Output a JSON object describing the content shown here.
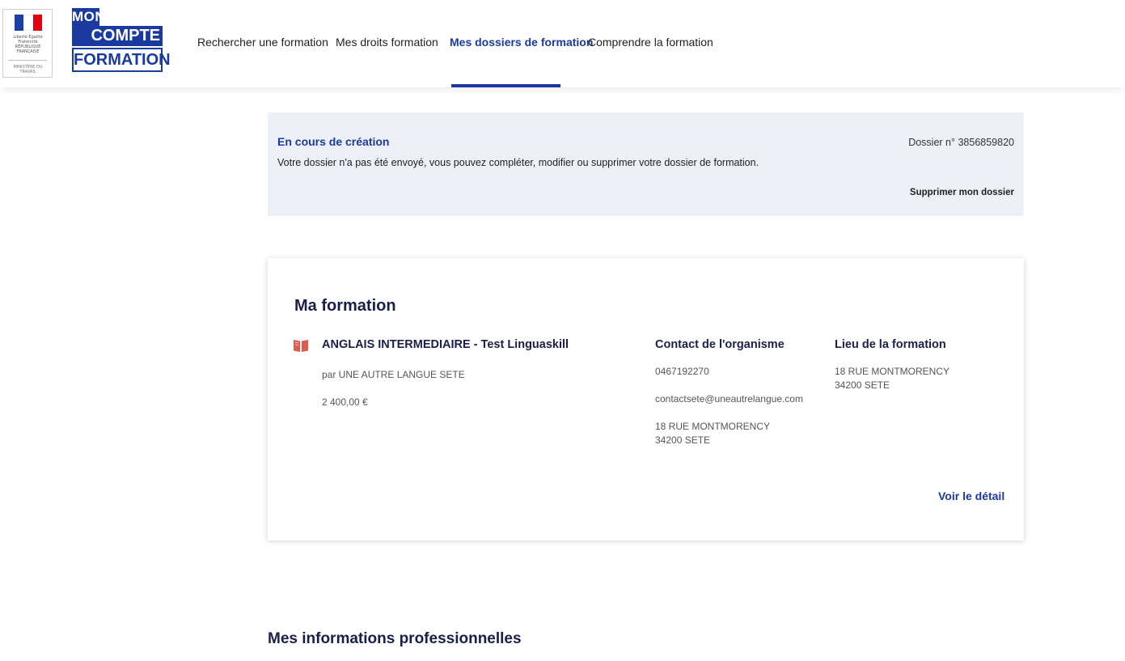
{
  "header": {
    "mcf_logo": {
      "line1": "MON",
      "line2": "COMPTE",
      "line3": "FORMATION"
    },
    "marianne": {
      "text": "Liberté Égalité Fraternité RÉPUBLIQUE FRANÇAISE",
      "sub": "MINISTÈRE DU TRAVAIL"
    },
    "nav": [
      {
        "label": "Rechercher une formation"
      },
      {
        "label": "Mes droits formation"
      },
      {
        "label": "Mes dossiers de formation",
        "active": true
      },
      {
        "label": "Comprendre la formation"
      }
    ]
  },
  "status": {
    "title": "En cours de création",
    "description": "Votre dossier n'a pas été envoyé, vous pouvez compléter, modifier ou supprimer votre dossier de formation.",
    "dossier_number": "Dossier n° 3856859820",
    "delete_label": "Supprimer mon dossier"
  },
  "formation": {
    "section_title": "Ma formation",
    "course_title": "ANGLAIS INTERMEDIAIRE - Test Linguaskill",
    "organisme": "par UNE AUTRE LANGUE SETE",
    "price": "2 400,00 €",
    "contact": {
      "heading": "Contact de l'organisme",
      "phone": "0467192270",
      "email": "contactsete@uneautrelangue.com",
      "address_line1": "18 RUE MONTMORENCY",
      "address_line2": "34200 SETE"
    },
    "lieu": {
      "heading": "Lieu de la formation",
      "address_line1": "18 RUE MONTMORENCY",
      "address_line2": "34200 SETE"
    },
    "detail_label": "Voir le détail"
  },
  "pro_info": {
    "title": "Mes informations professionnelles"
  },
  "colors": {
    "primary": "#1a3aa0",
    "banner_bg": "#eef0f7",
    "icon_red": "#e05a4f",
    "heading_dark": "#1a1f4a"
  }
}
